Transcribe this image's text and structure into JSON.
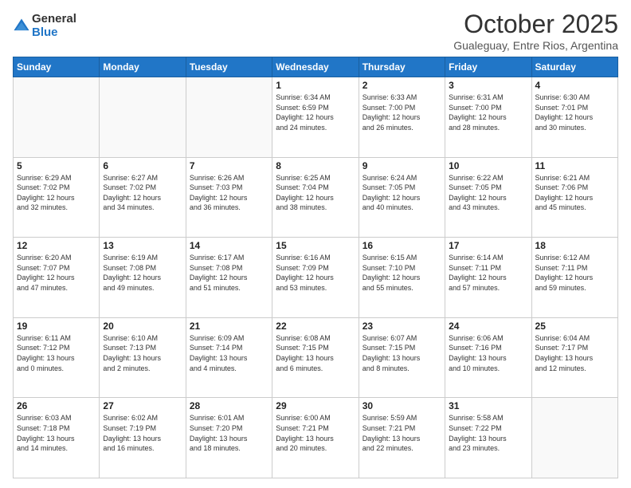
{
  "header": {
    "logo_general": "General",
    "logo_blue": "Blue",
    "month_title": "October 2025",
    "location": "Gualeguay, Entre Rios, Argentina"
  },
  "weekdays": [
    "Sunday",
    "Monday",
    "Tuesday",
    "Wednesday",
    "Thursday",
    "Friday",
    "Saturday"
  ],
  "weeks": [
    [
      {
        "day": "",
        "info": ""
      },
      {
        "day": "",
        "info": ""
      },
      {
        "day": "",
        "info": ""
      },
      {
        "day": "1",
        "info": "Sunrise: 6:34 AM\nSunset: 6:59 PM\nDaylight: 12 hours\nand 24 minutes."
      },
      {
        "day": "2",
        "info": "Sunrise: 6:33 AM\nSunset: 7:00 PM\nDaylight: 12 hours\nand 26 minutes."
      },
      {
        "day": "3",
        "info": "Sunrise: 6:31 AM\nSunset: 7:00 PM\nDaylight: 12 hours\nand 28 minutes."
      },
      {
        "day": "4",
        "info": "Sunrise: 6:30 AM\nSunset: 7:01 PM\nDaylight: 12 hours\nand 30 minutes."
      }
    ],
    [
      {
        "day": "5",
        "info": "Sunrise: 6:29 AM\nSunset: 7:02 PM\nDaylight: 12 hours\nand 32 minutes."
      },
      {
        "day": "6",
        "info": "Sunrise: 6:27 AM\nSunset: 7:02 PM\nDaylight: 12 hours\nand 34 minutes."
      },
      {
        "day": "7",
        "info": "Sunrise: 6:26 AM\nSunset: 7:03 PM\nDaylight: 12 hours\nand 36 minutes."
      },
      {
        "day": "8",
        "info": "Sunrise: 6:25 AM\nSunset: 7:04 PM\nDaylight: 12 hours\nand 38 minutes."
      },
      {
        "day": "9",
        "info": "Sunrise: 6:24 AM\nSunset: 7:05 PM\nDaylight: 12 hours\nand 40 minutes."
      },
      {
        "day": "10",
        "info": "Sunrise: 6:22 AM\nSunset: 7:05 PM\nDaylight: 12 hours\nand 43 minutes."
      },
      {
        "day": "11",
        "info": "Sunrise: 6:21 AM\nSunset: 7:06 PM\nDaylight: 12 hours\nand 45 minutes."
      }
    ],
    [
      {
        "day": "12",
        "info": "Sunrise: 6:20 AM\nSunset: 7:07 PM\nDaylight: 12 hours\nand 47 minutes."
      },
      {
        "day": "13",
        "info": "Sunrise: 6:19 AM\nSunset: 7:08 PM\nDaylight: 12 hours\nand 49 minutes."
      },
      {
        "day": "14",
        "info": "Sunrise: 6:17 AM\nSunset: 7:08 PM\nDaylight: 12 hours\nand 51 minutes."
      },
      {
        "day": "15",
        "info": "Sunrise: 6:16 AM\nSunset: 7:09 PM\nDaylight: 12 hours\nand 53 minutes."
      },
      {
        "day": "16",
        "info": "Sunrise: 6:15 AM\nSunset: 7:10 PM\nDaylight: 12 hours\nand 55 minutes."
      },
      {
        "day": "17",
        "info": "Sunrise: 6:14 AM\nSunset: 7:11 PM\nDaylight: 12 hours\nand 57 minutes."
      },
      {
        "day": "18",
        "info": "Sunrise: 6:12 AM\nSunset: 7:11 PM\nDaylight: 12 hours\nand 59 minutes."
      }
    ],
    [
      {
        "day": "19",
        "info": "Sunrise: 6:11 AM\nSunset: 7:12 PM\nDaylight: 13 hours\nand 0 minutes."
      },
      {
        "day": "20",
        "info": "Sunrise: 6:10 AM\nSunset: 7:13 PM\nDaylight: 13 hours\nand 2 minutes."
      },
      {
        "day": "21",
        "info": "Sunrise: 6:09 AM\nSunset: 7:14 PM\nDaylight: 13 hours\nand 4 minutes."
      },
      {
        "day": "22",
        "info": "Sunrise: 6:08 AM\nSunset: 7:15 PM\nDaylight: 13 hours\nand 6 minutes."
      },
      {
        "day": "23",
        "info": "Sunrise: 6:07 AM\nSunset: 7:15 PM\nDaylight: 13 hours\nand 8 minutes."
      },
      {
        "day": "24",
        "info": "Sunrise: 6:06 AM\nSunset: 7:16 PM\nDaylight: 13 hours\nand 10 minutes."
      },
      {
        "day": "25",
        "info": "Sunrise: 6:04 AM\nSunset: 7:17 PM\nDaylight: 13 hours\nand 12 minutes."
      }
    ],
    [
      {
        "day": "26",
        "info": "Sunrise: 6:03 AM\nSunset: 7:18 PM\nDaylight: 13 hours\nand 14 minutes."
      },
      {
        "day": "27",
        "info": "Sunrise: 6:02 AM\nSunset: 7:19 PM\nDaylight: 13 hours\nand 16 minutes."
      },
      {
        "day": "28",
        "info": "Sunrise: 6:01 AM\nSunset: 7:20 PM\nDaylight: 13 hours\nand 18 minutes."
      },
      {
        "day": "29",
        "info": "Sunrise: 6:00 AM\nSunset: 7:21 PM\nDaylight: 13 hours\nand 20 minutes."
      },
      {
        "day": "30",
        "info": "Sunrise: 5:59 AM\nSunset: 7:21 PM\nDaylight: 13 hours\nand 22 minutes."
      },
      {
        "day": "31",
        "info": "Sunrise: 5:58 AM\nSunset: 7:22 PM\nDaylight: 13 hours\nand 23 minutes."
      },
      {
        "day": "",
        "info": ""
      }
    ]
  ]
}
